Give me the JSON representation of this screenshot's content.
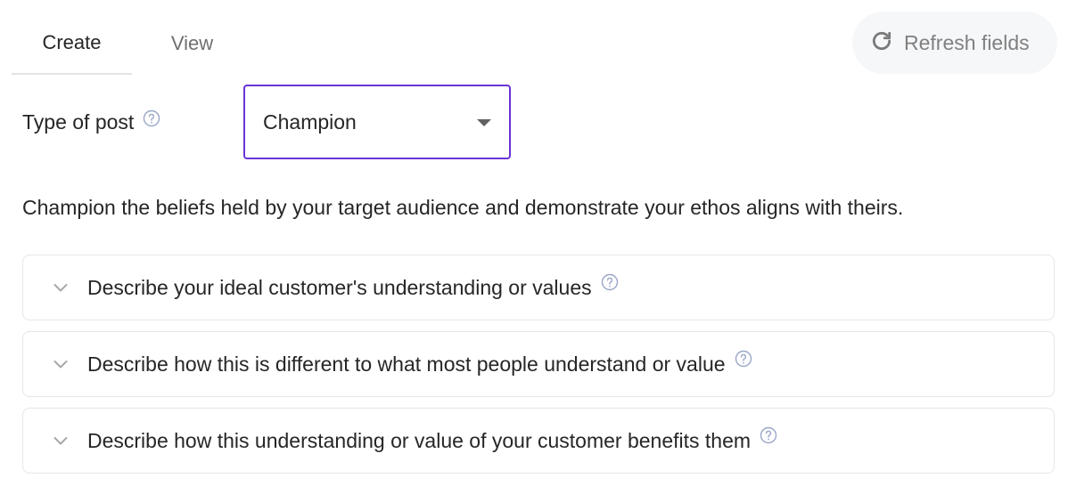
{
  "tabs": [
    {
      "label": "Create",
      "active": true
    },
    {
      "label": "View",
      "active": false
    }
  ],
  "refresh_button": {
    "label": "Refresh fields",
    "icon": "refresh-icon"
  },
  "type_of_post": {
    "label": "Type of post",
    "selected": "Champion"
  },
  "description": "Champion the beliefs held by your target audience and demonstrate your ethos aligns with theirs.",
  "sections": [
    {
      "title": "Describe your ideal customer's understanding or values"
    },
    {
      "title": "Describe how this is different to what most people understand or value"
    },
    {
      "title": "Describe how this understanding or value of your customer benefits them"
    }
  ],
  "colors": {
    "accent": "#6b33d6",
    "help_icon": "#9aa6c8",
    "muted_text": "#808080"
  }
}
